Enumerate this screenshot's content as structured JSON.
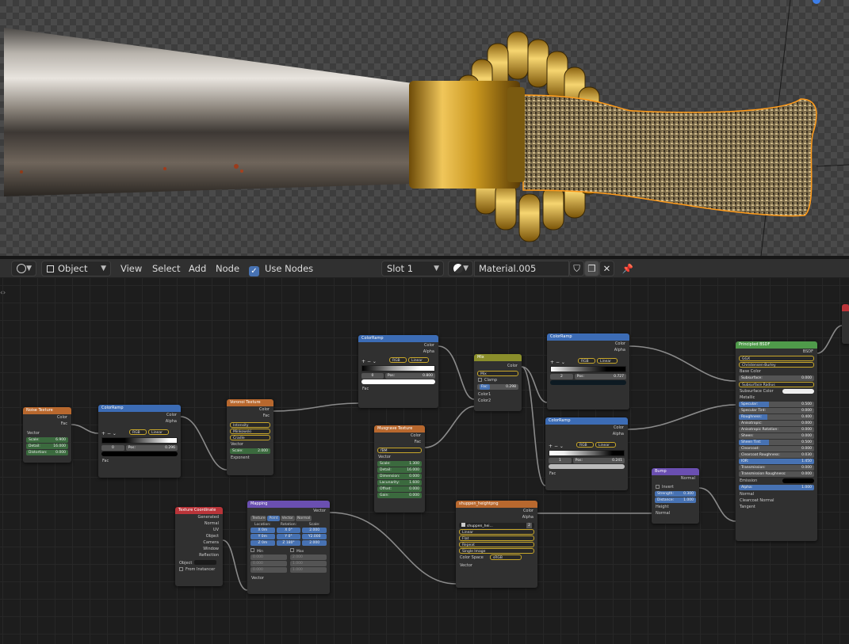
{
  "header": {
    "editor_type_icon": "node-editor-icon",
    "object_mode": "Object",
    "menus": [
      "View",
      "Select",
      "Add",
      "Node"
    ],
    "use_nodes_label": "Use Nodes",
    "use_nodes_checked": true,
    "slot": "Slot 1",
    "material_name": "Material.005"
  },
  "colors": {
    "header_blue": "#3c6cb5",
    "header_orange": "#b8682e",
    "header_red": "#b93439",
    "header_purple": "#6a4fb1",
    "header_olive": "#8a8e2b",
    "socket_gray": "#a1a1a1",
    "socket_yellow": "#c7c729",
    "socket_purple": "#6363c7",
    "socket_green": "#63c763"
  },
  "nodes": {
    "noise": {
      "title": "Noise Texture",
      "outputs": [
        "Color",
        "Fac"
      ],
      "input": "Vector",
      "fields": [
        "Scale:",
        "Detail:",
        "Distortion:"
      ],
      "values": [
        "6.900",
        "16.000",
        "0.000"
      ]
    },
    "cr1": {
      "title": "ColorRamp",
      "outputs": [
        "Color",
        "Alpha"
      ],
      "mode": "RGB",
      "interp": "Linear",
      "index": "0",
      "pos_label": "Pos:",
      "pos": "0.296",
      "input": "Fac"
    },
    "voronoi": {
      "title": "Voronoi Texture",
      "outputs": [
        "Color",
        "Fac"
      ],
      "drops": [
        "Intensity",
        "Minkowski",
        "Cradle"
      ],
      "input": "Vector",
      "scale_label": "Scale:",
      "scale": "2.000",
      "exponent": "Exponent"
    },
    "cr2": {
      "title": "ColorRamp",
      "outputs": [
        "Color",
        "Alpha"
      ],
      "mode": "RGB",
      "interp": "Linear",
      "index": "0",
      "pos_label": "Pos:",
      "pos": "0.800",
      "input": "Fac"
    },
    "musgrave": {
      "title": "Musgrave Texture",
      "outputs": [
        "Color",
        "Fac"
      ],
      "type": "fBM",
      "input": "Vector",
      "fields": [
        "Scale:",
        "Detail:",
        "Dimension:",
        "Lacunarity:",
        "Offset:",
        "Gain:"
      ],
      "values": [
        "1.300",
        "16.000",
        "0.000",
        "1.600",
        "0.000",
        "0.000"
      ]
    },
    "mix": {
      "title": "Mix",
      "output": "Color",
      "blend": "Mix",
      "clamp": "Clamp",
      "fac_label": "Fac:",
      "fac": "0.298",
      "inputs": [
        "Color1",
        "Color2"
      ]
    },
    "cr3": {
      "title": "ColorRamp",
      "outputs": [
        "Color",
        "Alpha"
      ],
      "mode": "RGB",
      "interp": "Linear",
      "index": "2",
      "pos_label": "Pos:",
      "pos": "0.727",
      "input": "Fac"
    },
    "cr4": {
      "title": "ColorRamp",
      "outputs": [
        "Color",
        "Alpha"
      ],
      "mode": "RGB",
      "interp": "Linear",
      "index": "1",
      "pos_label": "Pos:",
      "pos": "0.241",
      "input": "Fac"
    },
    "bump": {
      "title": "Bump",
      "output": "Normal",
      "invert": "Invert",
      "fields": [
        "Strength:",
        "Distance:"
      ],
      "values": [
        "0.300",
        "1.000"
      ],
      "inputs": [
        "Height",
        "Normal"
      ]
    },
    "texcoord": {
      "title": "Texture Coordinate",
      "outputs": [
        "Generated",
        "Normal",
        "UV",
        "Object",
        "Camera",
        "Window",
        "Reflection"
      ],
      "object_label": "Object",
      "from_instancer": "From Instancer"
    },
    "mapping": {
      "title": "Mapping",
      "output": "Vector",
      "tabs": [
        "Texture",
        "Point",
        "Vector",
        "Normal"
      ],
      "cols": [
        "Location:",
        "Rotation:",
        "Scale:"
      ],
      "loc": [
        "X  0m",
        "Y  0m",
        "Z  0m"
      ],
      "rot": [
        "X  0°",
        "Y  0°",
        "Z  180°"
      ],
      "scl": [
        "2.000",
        "Y2.000",
        "2.000"
      ],
      "min": "Min",
      "max": "Max",
      "minv": [
        "0.000",
        "0.000",
        "0.000"
      ],
      "maxv": [
        "2.000",
        "1.000",
        "1.000"
      ],
      "input": "Vector"
    },
    "image": {
      "title": "shuppen_heightpng",
      "outputs": [
        "Color",
        "Alpha"
      ],
      "file": "shuppen_hei...",
      "users": "2",
      "drops": [
        "Linear",
        "Flat",
        "Repeat",
        "Single Image"
      ],
      "cs_label": "Color Space",
      "cs": "sRGB",
      "input": "Vector"
    },
    "bsdf": {
      "title": "Principled BSDF",
      "output": "BSDF",
      "drops": [
        "GGX",
        "Christensen-Burley"
      ],
      "base_color": "Base Color",
      "subsurface": "Subsurface:",
      "subsurface_v": "0.000",
      "ss_radius": "Subsurface Radius",
      "ss_color": "Subsurface Color",
      "metallic": "Metallic",
      "fields": [
        "Specular:",
        "Specular Tint:",
        "Roughness:",
        "Anisotropic:",
        "Anisotropic Rotation:",
        "Sheen:",
        "Sheen Tint:",
        "Clearcoat:",
        "Clearcoat Roughness:",
        "IOR:",
        "Transmission:",
        "Transmission Roughness:"
      ],
      "values": [
        "0.500",
        "0.000",
        "0.400",
        "0.000",
        "0.000",
        "0.000",
        "0.500",
        "0.000",
        "0.030",
        "1.450",
        "0.000",
        "0.000"
      ],
      "emission": "Emission",
      "alpha_label": "Alpha:",
      "alpha": "1.000",
      "tail": [
        "Normal",
        "Clearcoat Normal",
        "Tangent"
      ]
    }
  }
}
